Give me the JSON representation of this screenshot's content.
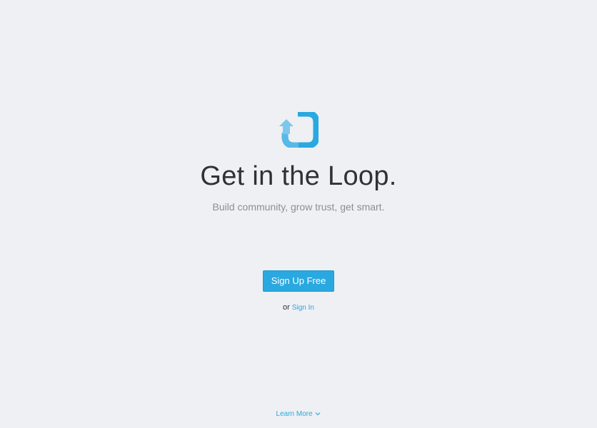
{
  "hero": {
    "logo_icon": "loop-arrow-icon",
    "headline": "Get in the Loop.",
    "tagline": "Build community, grow trust, get smart."
  },
  "actions": {
    "signup_label": "Sign Up Free",
    "or_text": "or",
    "signin_label": "Sign In"
  },
  "footer": {
    "learn_more_label": "Learn More",
    "learn_more_icon": "chevron-down-icon"
  },
  "colors": {
    "background": "#eef0f3",
    "accent": "#2aa8e0",
    "accent_light": "#7cc8ec",
    "headline": "#2e3238",
    "tagline": "#8a8f96"
  }
}
